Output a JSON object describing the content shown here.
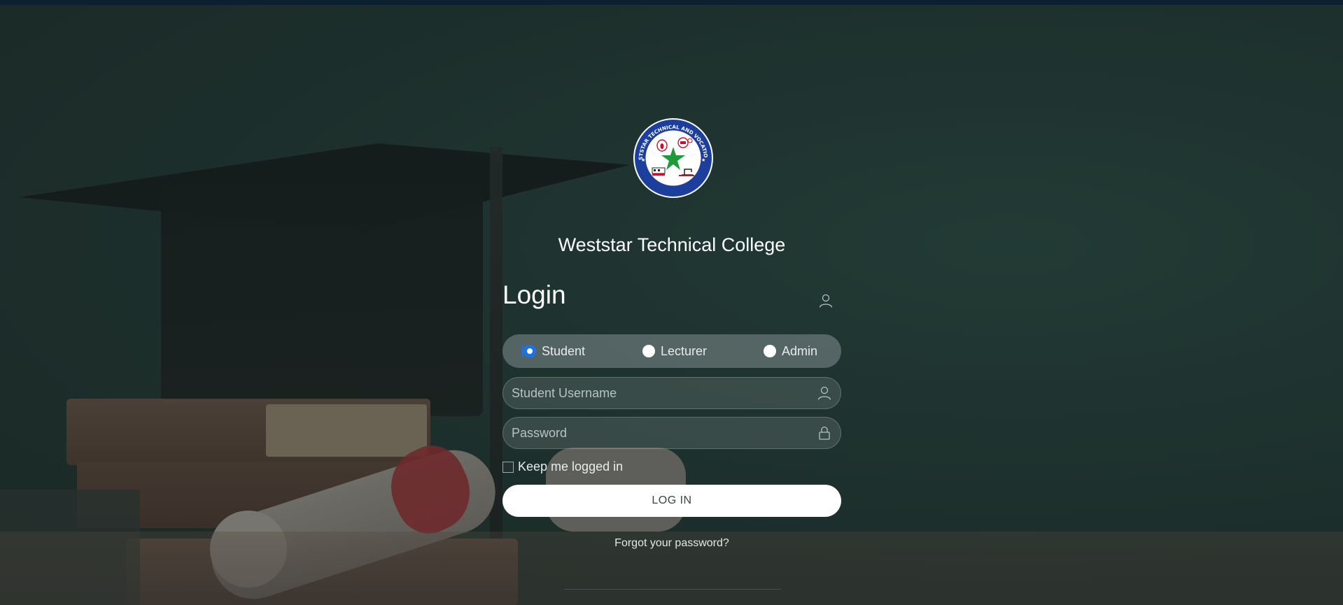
{
  "college": {
    "name": "Weststar Technical College",
    "logo_text_top": "WESTSTAR TECHNICAL AND VOCATIONAL",
    "logo_text_bottom": "TRAINING CENTRE"
  },
  "login": {
    "heading": "Login",
    "roles": [
      {
        "label": "Student",
        "selected": true
      },
      {
        "label": "Lecturer",
        "selected": false
      },
      {
        "label": "Admin",
        "selected": false
      }
    ],
    "username_placeholder": "Student Username",
    "username_value": "",
    "password_placeholder": "Password",
    "password_value": "",
    "keep_logged_in_label": "Keep me logged in",
    "keep_logged_in_checked": false,
    "submit_label": "LOG IN",
    "forgot_label": "Forgot your password?"
  },
  "icons": {
    "header": "user-icon",
    "username_field": "user-icon",
    "password_field": "lock-icon"
  },
  "colors": {
    "accent": "#1a73e8",
    "logo_ring": "#1c3f9e",
    "logo_star": "#1f9a3a",
    "background": "#1f302d"
  }
}
